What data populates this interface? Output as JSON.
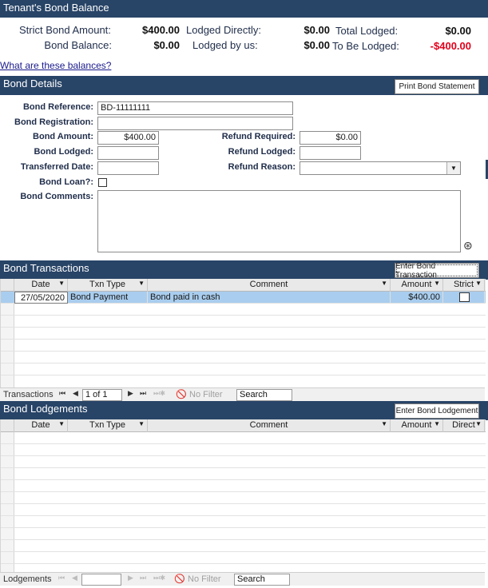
{
  "balance": {
    "title": "Tenant's Bond Balance",
    "strict_label": "Strict Bond Amount:",
    "strict_value": "$400.00",
    "bond_balance_label": "Bond Balance:",
    "bond_balance_value": "$0.00",
    "lodged_directly_label": "Lodged Directly:",
    "lodged_directly_value": "$0.00",
    "lodged_by_us_label": "Lodged by us:",
    "lodged_by_us_value": "$0.00",
    "total_lodged_label": "Total Lodged:",
    "total_lodged_value": "$0.00",
    "to_be_lodged_label": "To Be Lodged:",
    "to_be_lodged_value": "-$400.00",
    "help_link": "What are these balances?",
    "negative_color": "#e0001b"
  },
  "details": {
    "title": "Bond Details",
    "print_button": "Print Bond Statement",
    "bond_reference_label": "Bond Reference:",
    "bond_reference_value": "BD-11111111",
    "bond_registration_label": "Bond Registration:",
    "bond_registration_value": "",
    "bond_amount_label": "Bond Amount:",
    "bond_amount_value": "$400.00",
    "bond_lodged_label": "Bond Lodged:",
    "bond_lodged_value": "",
    "transferred_date_label": "Transferred Date:",
    "transferred_date_value": "",
    "bond_loan_label": "Bond Loan?:",
    "bond_comments_label": "Bond Comments:",
    "refund_required_label": "Refund Required:",
    "refund_required_value": "$0.00",
    "refund_lodged_label": "Refund Lodged:",
    "refund_lodged_value": "",
    "refund_reason_label": "Refund Reason:",
    "refund_reason_value": ""
  },
  "transactions": {
    "title": "Bond Transactions",
    "enter_button": "Enter Bond Transaction",
    "columns": [
      "Date",
      "Txn Type",
      "Comment",
      "Amount",
      "Strict"
    ],
    "rows": [
      {
        "date": "27/05/2020",
        "type": "Bond Payment",
        "comment": "Bond paid in cash",
        "amount": "$400.00"
      }
    ],
    "nav_label": "Transactions",
    "record": "1 of 1",
    "filter": "No Filter",
    "search": "Search"
  },
  "lodgements": {
    "title": "Bond Lodgements",
    "enter_button": "Enter Bond Lodgement",
    "columns": [
      "Date",
      "Txn Type",
      "Comment",
      "Amount",
      "Direct"
    ],
    "nav_label": "Lodgements",
    "record": "",
    "filter": "No Filter",
    "search": "Search"
  },
  "colors": {
    "header_bg": "#284467",
    "selected_row": "#a9cdee"
  }
}
